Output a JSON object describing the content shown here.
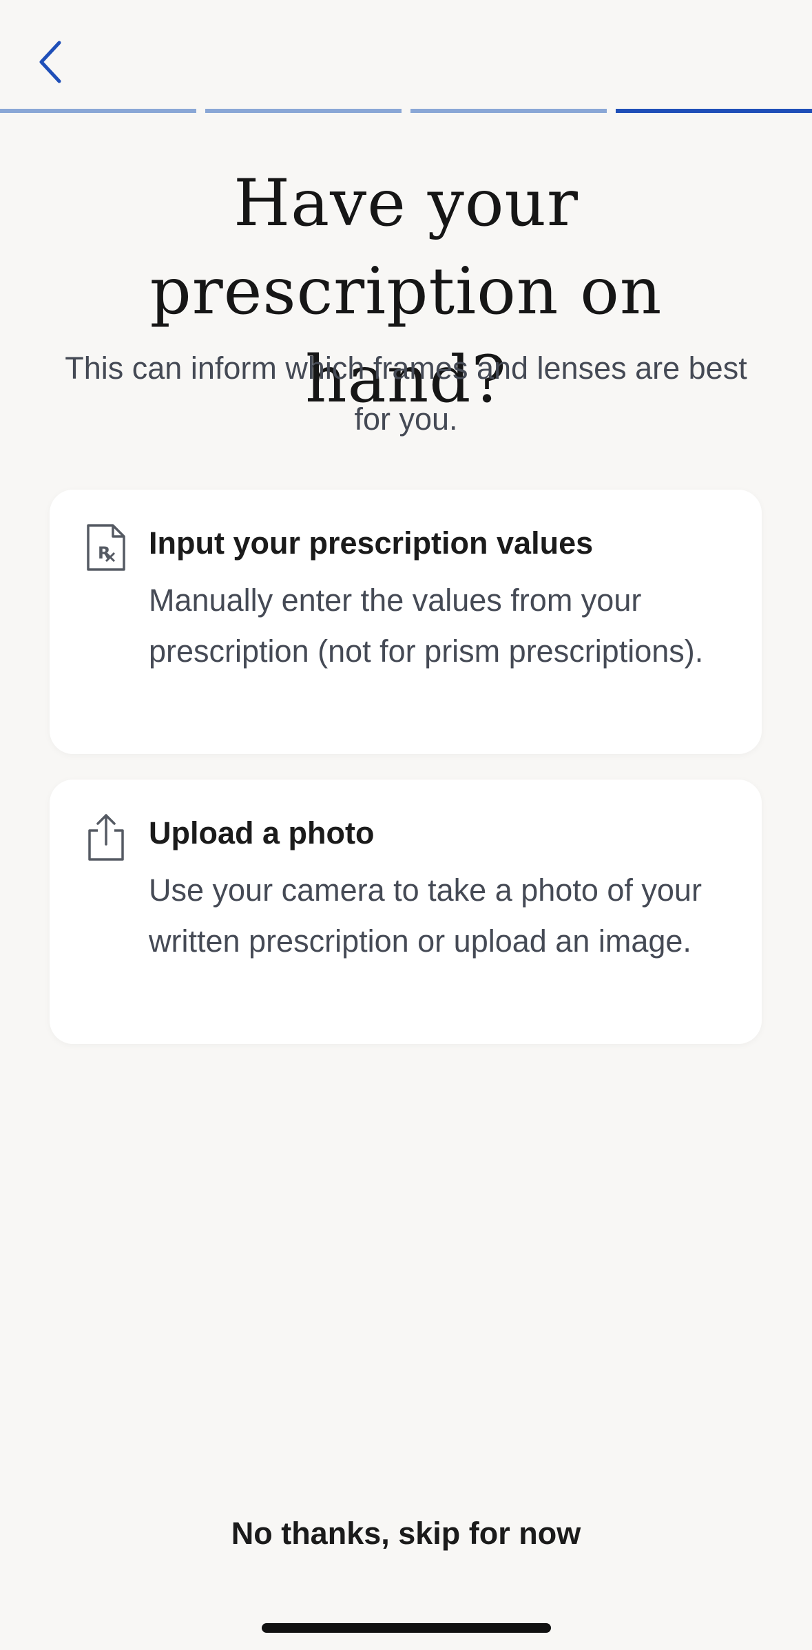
{
  "nav": {
    "back_icon": "chevron-left-icon",
    "accent_color": "#1f4fb8"
  },
  "progress": {
    "total_steps": 4,
    "current_step": 4
  },
  "header": {
    "title_line1": "Have your",
    "title_line2": "prescription on hand?",
    "subtitle": "This can inform which frames and lenses are best for you."
  },
  "options": [
    {
      "icon": "prescription-rx-icon",
      "title": "Input your prescription values",
      "description": "Manually enter the values from your prescription (not for prism prescriptions)."
    },
    {
      "icon": "upload-share-icon",
      "title": "Upload a photo",
      "description": "Use your camera to take a photo of your written prescription or upload an image."
    }
  ],
  "footer": {
    "skip_label": "No thanks, skip for now"
  }
}
